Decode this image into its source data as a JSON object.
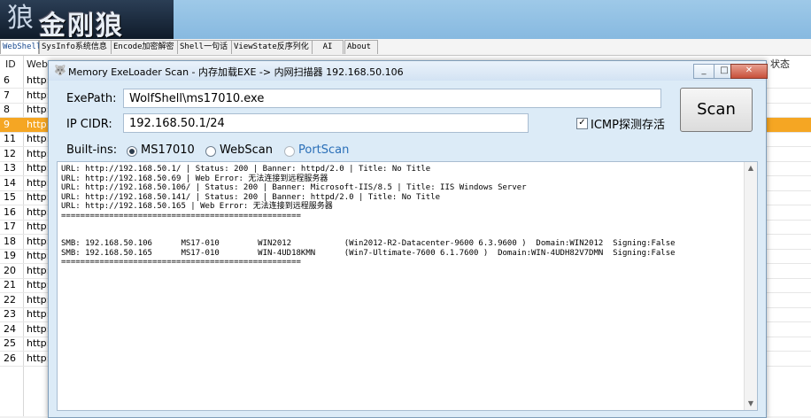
{
  "app": {
    "logo_mark": "狼",
    "logo_text": "金刚狼"
  },
  "menu_tabs": [
    "WebShell",
    "SysInfo系统信息",
    "Encode加密解密",
    "Shell一句话",
    "ViewState反序列化",
    "AI",
    "About"
  ],
  "grid": {
    "col_id": "ID",
    "col_url": "WebS",
    "col_status": "状态",
    "rows": [
      {
        "id": "6",
        "url": "http:/"
      },
      {
        "id": "7",
        "url": "http:/"
      },
      {
        "id": "8",
        "url": "http:/"
      },
      {
        "id": "9",
        "url": "http:/",
        "selected": true
      },
      {
        "id": "11",
        "url": "http:/"
      },
      {
        "id": "12",
        "url": "http:/"
      },
      {
        "id": "13",
        "url": "http:/"
      },
      {
        "id": "14",
        "url": "http:/"
      },
      {
        "id": "15",
        "url": "http:/"
      },
      {
        "id": "16",
        "url": "http:/"
      },
      {
        "id": "17",
        "url": "http:/"
      },
      {
        "id": "18",
        "url": "http:/"
      },
      {
        "id": "19",
        "url": "http:/"
      },
      {
        "id": "20",
        "url": "http:/"
      },
      {
        "id": "21",
        "url": "http:/"
      },
      {
        "id": "22",
        "url": "http:/"
      },
      {
        "id": "23",
        "url": "http:/"
      },
      {
        "id": "24",
        "url": "http:/"
      },
      {
        "id": "25",
        "url": "http:/"
      },
      {
        "id": "26",
        "url": "http:/"
      }
    ]
  },
  "dialog": {
    "title": "Memory ExeLoader Scan - 内存加载EXE -> 内网扫描器 192.168.50.106",
    "exe_label": "ExePath:",
    "exe_value": "WolfShell\\ms17010.exe",
    "cidr_label": "IP CIDR:",
    "cidr_value": "192.168.50.1/24",
    "icmp_label": "ICMP探测存活",
    "icmp_checked": true,
    "scan_label": "Scan",
    "builtins_label": "Built-ins:",
    "options": [
      {
        "label": "MS17010",
        "selected": true,
        "enabled": true
      },
      {
        "label": "WebScan",
        "selected": false,
        "enabled": true
      },
      {
        "label": "PortScan",
        "selected": false,
        "enabled": false
      }
    ],
    "output_lines": [
      "URL: http://192.168.50.1/ | Status: 200 | Banner: httpd/2.0 | Title: No Title",
      "URL: http://192.168.50.69 | Web Error: 无法连接到远程服务器",
      "URL: http://192.168.50.106/ | Status: 200 | Banner: Microsoft-IIS/8.5 | Title: IIS Windows Server",
      "URL: http://192.168.50.141/ | Status: 200 | Banner: httpd/2.0 | Title: No Title",
      "URL: http://192.168.50.165 | Web Error: 无法连接到远程服务器",
      "==================================================",
      "",
      "",
      "SMB: 192.168.50.106      MS17-010        WIN2012           (Win2012-R2-Datacenter-9600 6.3.9600 )  Domain:WIN2012  Signing:False",
      "SMB: 192.168.50.165      MS17-010        WIN-4UD18KMN      (Win7-Ultimate-7600 6.1.7600 )  Domain:WIN-4UDH82V7DMN  Signing:False",
      "=================================================="
    ]
  }
}
